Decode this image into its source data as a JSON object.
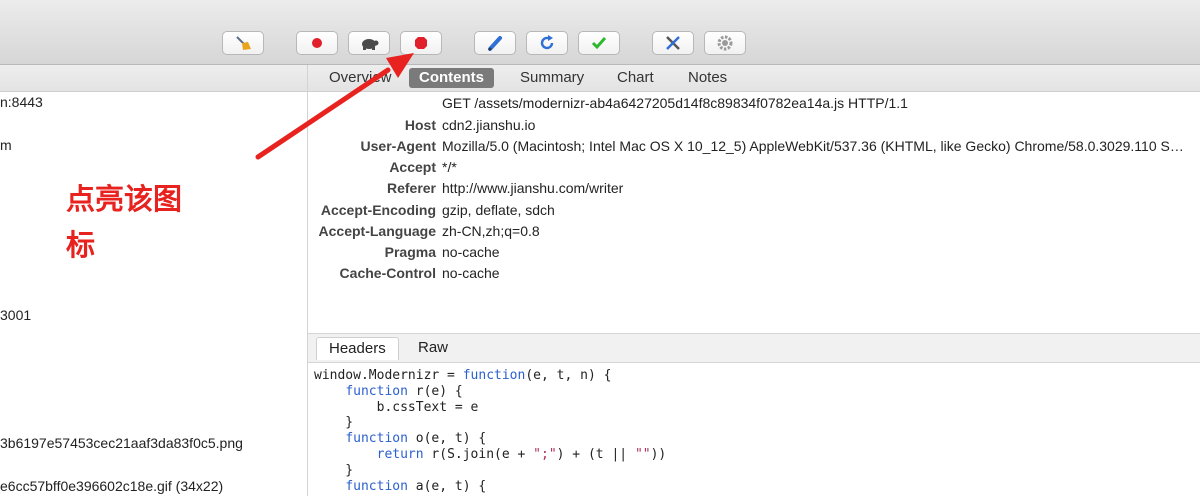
{
  "toolbar": {
    "buttons": [
      {
        "name": "broom-clear-button",
        "icon": "broom-icon"
      },
      {
        "name": "record-button",
        "icon": "record-dot-icon"
      },
      {
        "name": "throttle-button",
        "icon": "turtle-icon"
      },
      {
        "name": "breakpoint-button",
        "icon": "stop-octagon-icon"
      },
      {
        "name": "compose-button",
        "icon": "pen-icon"
      },
      {
        "name": "repeat-button",
        "icon": "refresh-icon"
      },
      {
        "name": "validate-button",
        "icon": "checkmark-icon"
      },
      {
        "name": "tools-button",
        "icon": "wrench-screwdriver-icon"
      },
      {
        "name": "settings-button",
        "icon": "gear-icon"
      }
    ]
  },
  "tabs": [
    "Overview",
    "Contents",
    "Summary",
    "Chart",
    "Notes"
  ],
  "active_tab": "Contents",
  "left_list": [
    "n:8443",
    "m",
    "3001",
    "3b6197e57453cec21aaf3da83f0c5.png",
    "e6cc57bff0e396602c18e.gif (34x22)"
  ],
  "request_line": "GET /assets/modernizr-ab4a6427205d14f8c89834f0782ea14a.js HTTP/1.1",
  "headers": [
    {
      "key": "Host",
      "value": "cdn2.jianshu.io"
    },
    {
      "key": "User-Agent",
      "value": "Mozilla/5.0 (Macintosh; Intel Mac OS X 10_12_5) AppleWebKit/537.36 (KHTML, like Gecko) Chrome/58.0.3029.110 S…"
    },
    {
      "key": "Accept",
      "value": "*/*"
    },
    {
      "key": "Referer",
      "value": "http://www.jianshu.com/writer"
    },
    {
      "key": "Accept-Encoding",
      "value": "gzip, deflate, sdch"
    },
    {
      "key": "Accept-Language",
      "value": "zh-CN,zh;q=0.8"
    },
    {
      "key": "Pragma",
      "value": "no-cache"
    },
    {
      "key": "Cache-Control",
      "value": "no-cache"
    }
  ],
  "subtabs": [
    "Headers",
    "Raw"
  ],
  "active_subtab": "Headers",
  "code_lines": [
    "window.Modernizr = function(e, t, n) {",
    "    function r(e) {",
    "        b.cssText = e",
    "    }",
    "    function o(e, t) {",
    "        return r(S.join(e + \";\") + (t || \"\"))",
    "    }",
    "    function a(e, t) {"
  ],
  "annotation": {
    "line1": "点亮该图",
    "line2": "标"
  },
  "colors": {
    "annotation": "#e8231f",
    "record": "#e0202a",
    "check": "#2fb82f",
    "accent_blue": "#2f6fd6"
  }
}
